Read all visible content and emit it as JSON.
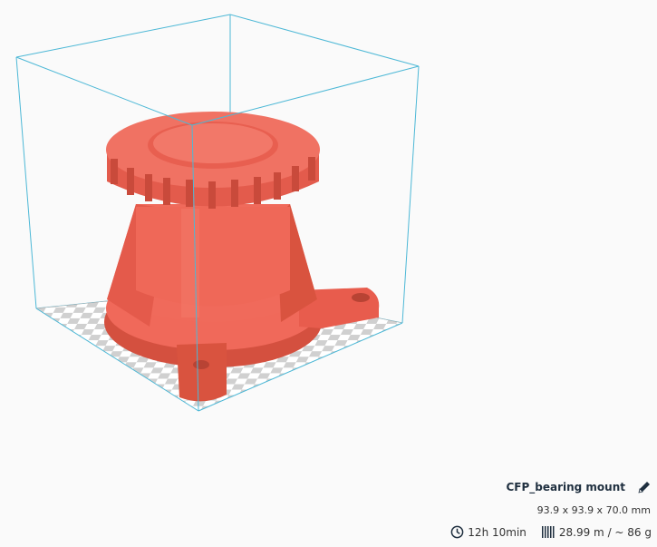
{
  "viewport": {
    "build_volume_color": "#4db8d6",
    "model_color": "#f0695a",
    "bed_checker_colors": [
      "#ffffff",
      "#d0d0d0"
    ]
  },
  "model": {
    "name": "CFP_bearing mount",
    "dimensions": "93.9 x 93.9 x 70.0 mm",
    "print_time": "12h 10min",
    "material": "28.99 m / ~ 86 g"
  },
  "icons": {
    "edit": "pencil-icon",
    "time": "clock-icon",
    "material": "spool-icon"
  }
}
